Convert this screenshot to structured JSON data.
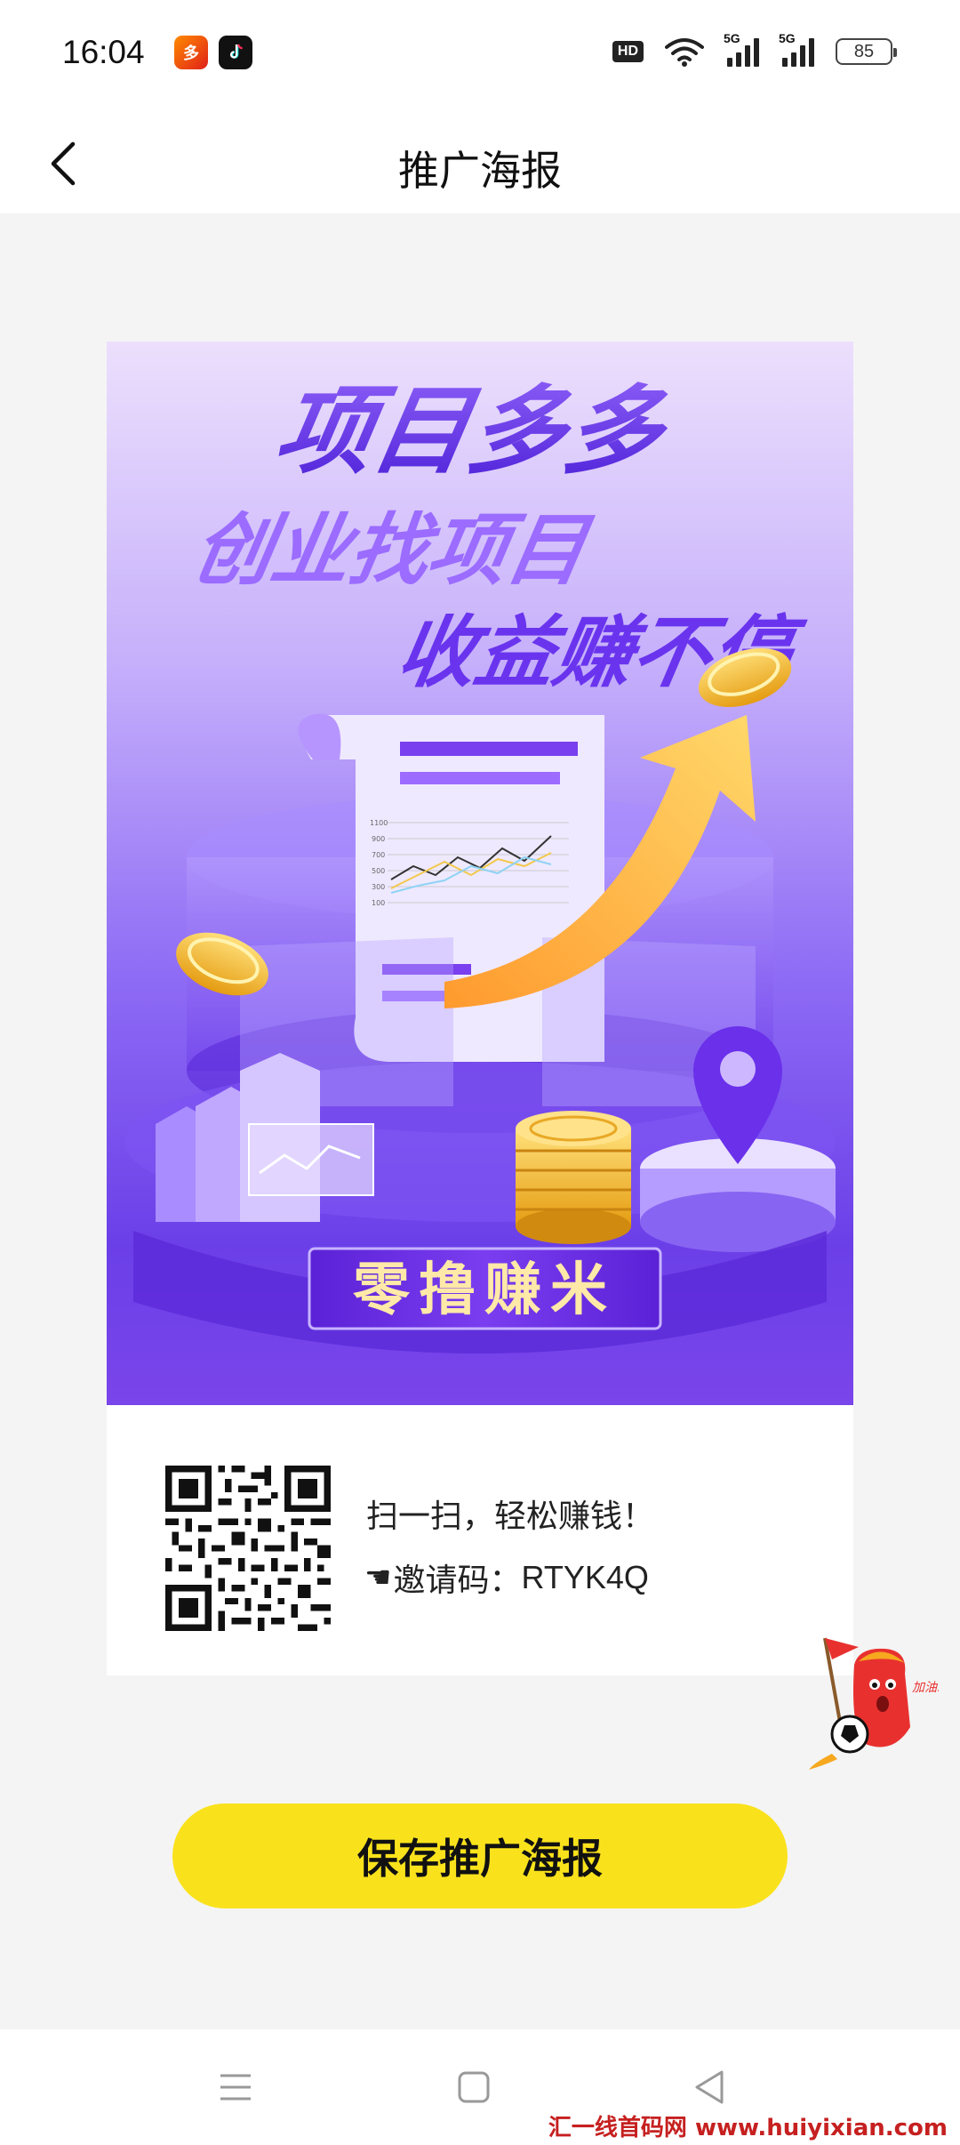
{
  "status_bar": {
    "time": "16:04",
    "hd_label": "HD",
    "signal1_label": "5G",
    "signal2_label": "5G",
    "battery": "85"
  },
  "header": {
    "title": "推广海报"
  },
  "poster": {
    "headline": "项目多多",
    "slogan_line1": "创业找项目",
    "slogan_line2": "收益赚不停",
    "banner": "零撸赚米",
    "scan_text": "扫一扫，轻松赚钱！",
    "invite_label": "邀请码：",
    "invite_code": "RTYK4Q",
    "chart_ticks": [
      "1100",
      "900",
      "700",
      "500",
      "300",
      "100"
    ]
  },
  "actions": {
    "save_label": "保存推广海报"
  },
  "watermark": "汇一线首码网 www.huiyixian.com",
  "colors": {
    "accent": "#f9e21c",
    "poster_purple": "#6b3fe8"
  }
}
